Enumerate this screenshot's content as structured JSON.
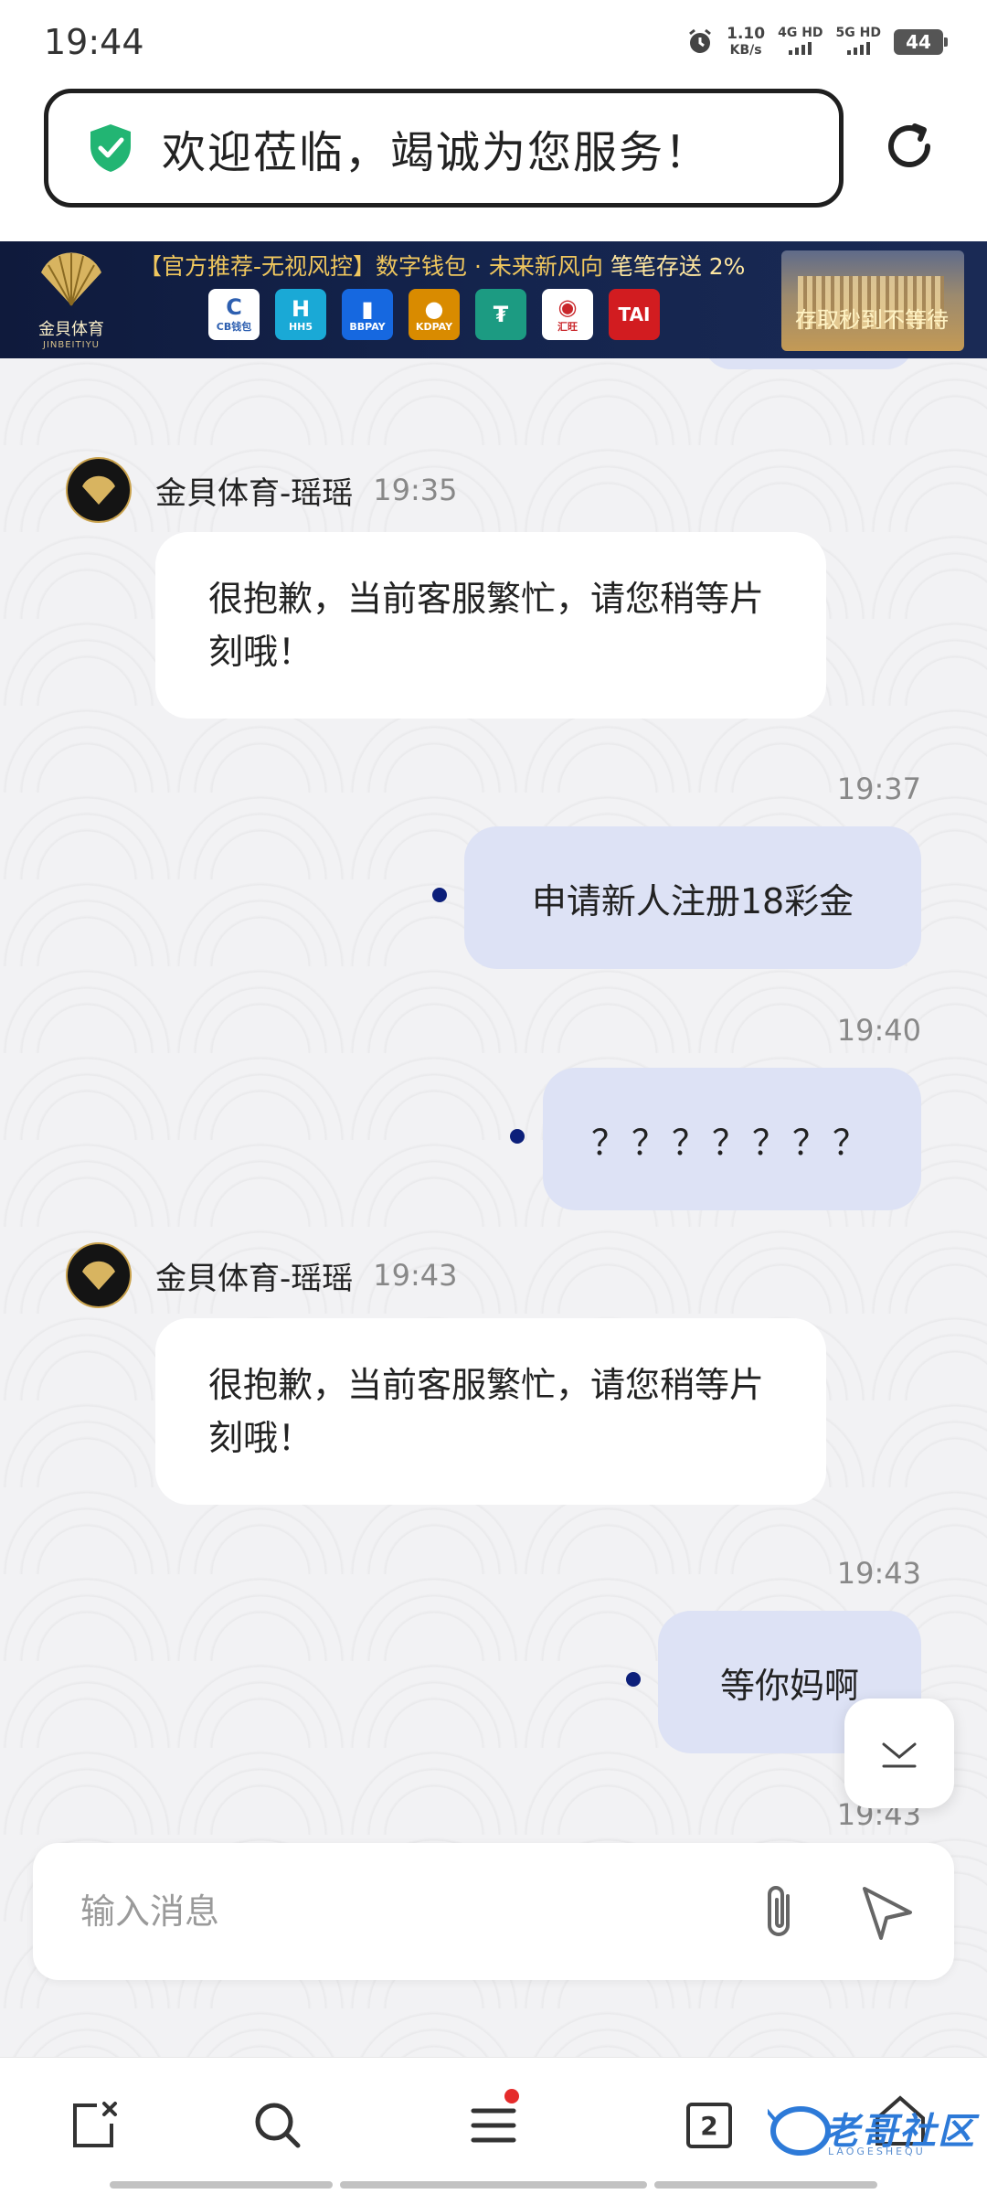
{
  "status_bar": {
    "time": "19:44",
    "speed": "1.10",
    "speed_unit": "KB/s",
    "net1": "4G HD",
    "net2": "5G HD",
    "battery": "44"
  },
  "welcome": {
    "text": "欢迎莅临，竭诚为您服务！",
    "shield_color": "#22b573"
  },
  "banner": {
    "logo_name": "金貝体育",
    "logo_sub": "JINBEITIYU",
    "headline_prefix": "【官方推荐-无视风控】数字钱包 · 未来新风向",
    "headline_highlight": "笔笔存送 2%",
    "payments": [
      {
        "label": "CB钱包",
        "glyph": "C"
      },
      {
        "label": "HH5",
        "glyph": "H"
      },
      {
        "label": "BBPAY",
        "glyph": "▮"
      },
      {
        "label": "KDPAY",
        "glyph": "●"
      },
      {
        "label": "",
        "glyph": "₮"
      },
      {
        "label": "汇旺",
        "glyph": "◉"
      },
      {
        "label": "",
        "glyph": "TAI"
      }
    ],
    "cta": "存取秒到不等待"
  },
  "chat": {
    "agent_name": "金貝体育-瑶瑶",
    "messages": [
      {
        "from": "agent",
        "time": "19:35",
        "text": "很抱歉，当前客服繁忙，请您稍等片刻哦！"
      },
      {
        "from": "user",
        "time": "19:37",
        "text": "申请新人注册18彩金"
      },
      {
        "from": "user",
        "time": "19:40",
        "text": "？？？？？？？"
      },
      {
        "from": "agent",
        "time": "19:43",
        "text": "很抱歉，当前客服繁忙，请您稍等片刻哦！"
      },
      {
        "from": "user",
        "time": "19:43",
        "text": "等你妈啊"
      }
    ],
    "trailing_time": "19:43"
  },
  "input": {
    "placeholder": "输入消息"
  },
  "bottom_nav": {
    "tabs_count": "2",
    "watermark": "老哥社区",
    "watermark_sub": "LAOGESHEQU"
  }
}
